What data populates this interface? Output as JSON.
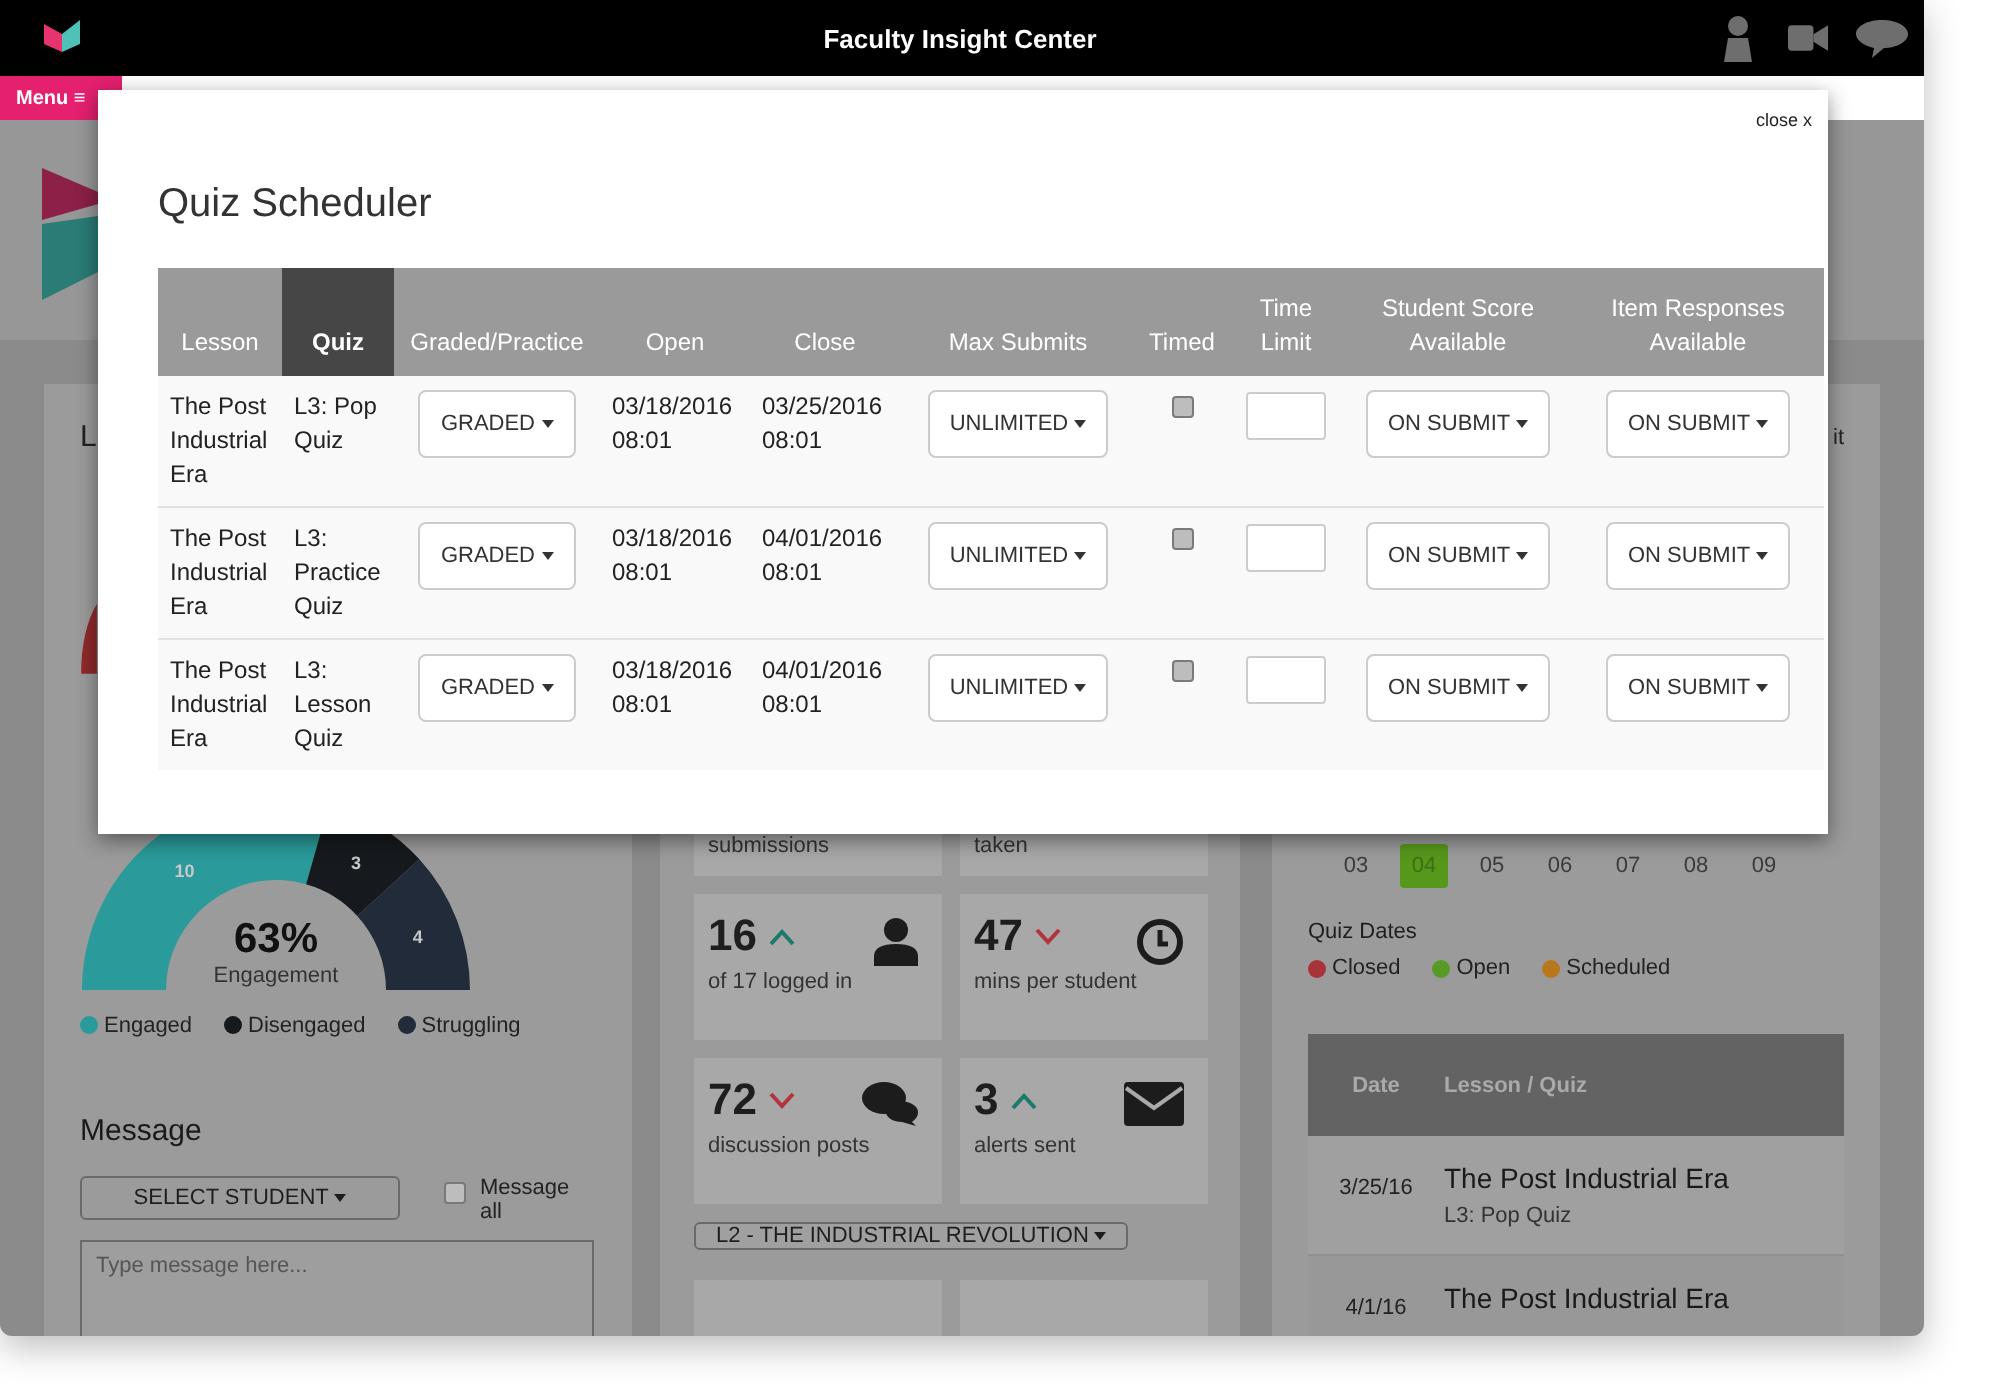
{
  "top_bar": {
    "title": "Faculty Insight Center"
  },
  "menu_button": {
    "label": "Menu ≡"
  },
  "left_panel": {
    "title": "L",
    "engagement": {
      "value": "63%",
      "label": "Engagement",
      "chart_data": {
        "type": "donut",
        "categories": [
          "Engaged",
          "Disengaged",
          "Struggling"
        ],
        "values": [
          10,
          3,
          4
        ],
        "data_labels": true
      }
    },
    "legend": [
      {
        "color": "#2a9a9a"
      },
      {
        "color": "#161a1e"
      },
      {
        "color": "#212b39"
      }
    ],
    "message": {
      "title": "Message",
      "select_button": "SELECT STUDENT",
      "message_all": {
        "label": "Message all",
        "checked": false
      },
      "placeholder": "Type message here..."
    }
  },
  "middle_panel": {
    "tiles": [
      {
        "kind": "partial",
        "label": "submissions"
      },
      {
        "kind": "partial",
        "label": "taken"
      },
      {
        "kind": "logins",
        "value": "16",
        "rising": true,
        "label": "of 17 logged in"
      },
      {
        "kind": "minutes",
        "value": "47",
        "rising": false,
        "label": "mins per student"
      },
      {
        "kind": "posts",
        "value": "72",
        "rising": false,
        "label": "discussion posts"
      },
      {
        "kind": "alerts",
        "value": "3",
        "rising": true,
        "label": "alerts sent"
      }
    ],
    "lesson_dropdown": "L2 - THE INDUSTRIAL REVOLUTION"
  },
  "right_panel": {
    "title": "it",
    "calendar_days": [
      {
        "label": "03",
        "selected": false
      },
      {
        "label": "04",
        "selected": true
      },
      {
        "label": "05",
        "selected": false
      },
      {
        "label": "06",
        "selected": false
      },
      {
        "label": "07",
        "selected": false
      },
      {
        "label": "08",
        "selected": false
      },
      {
        "label": "09",
        "selected": false
      }
    ],
    "quiz_dates_title": "Quiz Dates",
    "quiz_dates_legend": [
      {
        "label": "Closed",
        "color": "#a8343a"
      },
      {
        "label": "Open",
        "color": "#589a26"
      },
      {
        "label": "Scheduled",
        "color": "#b8781e"
      }
    ],
    "quiz_table": {
      "columns": [
        "Date",
        "Lesson / Quiz"
      ],
      "rows": [
        {
          "date": "3/25/16",
          "lesson": "The Post Industrial Era",
          "quiz": "L3: Pop Quiz"
        },
        {
          "date": "4/1/16",
          "lesson": "The Post Industrial Era"
        }
      ]
    }
  },
  "modal": {
    "title": "Quiz Scheduler",
    "close": "close x",
    "columns": [
      {
        "label": "Lesson",
        "selected": false
      },
      {
        "label": "Quiz",
        "selected": true
      },
      {
        "label": "Graded/Practice",
        "selected": false
      },
      {
        "label": "Open",
        "selected": false
      },
      {
        "label": "Close",
        "selected": false
      },
      {
        "label": "Max Submits",
        "selected": false
      },
      {
        "label": "Timed",
        "selected": false
      },
      {
        "label": "Time Limit",
        "selected": false
      },
      {
        "label": "Student Score Available",
        "selected": false
      },
      {
        "label": "Item Responses Available",
        "selected": false
      }
    ],
    "rows": [
      {
        "lesson": "The Post Industrial Era",
        "quiz": "L3: Pop Quiz",
        "graded": "GRADED",
        "open": "03/18/2016 08:01",
        "close": "03/25/2016 08:01",
        "max_submits": "UNLIMITED",
        "timed": false,
        "student_score": "ON SUBMIT",
        "item_responses": "ON SUBMIT"
      },
      {
        "lesson": "The Post Industrial Era",
        "quiz": "L3: Practice Quiz",
        "graded": "GRADED",
        "open": "03/18/2016 08:01",
        "close": "04/01/2016 08:01",
        "max_submits": "UNLIMITED",
        "timed": false,
        "student_score": "ON SUBMIT",
        "item_responses": "ON SUBMIT"
      },
      {
        "lesson": "The Post Industrial Era",
        "quiz": "L3: Lesson Quiz",
        "graded": "GRADED",
        "open": "03/18/2016 08:01",
        "close": "04/01/2016 08:01",
        "max_submits": "UNLIMITED",
        "timed": false,
        "student_score": "ON SUBMIT",
        "item_responses": "ON SUBMIT"
      }
    ]
  }
}
